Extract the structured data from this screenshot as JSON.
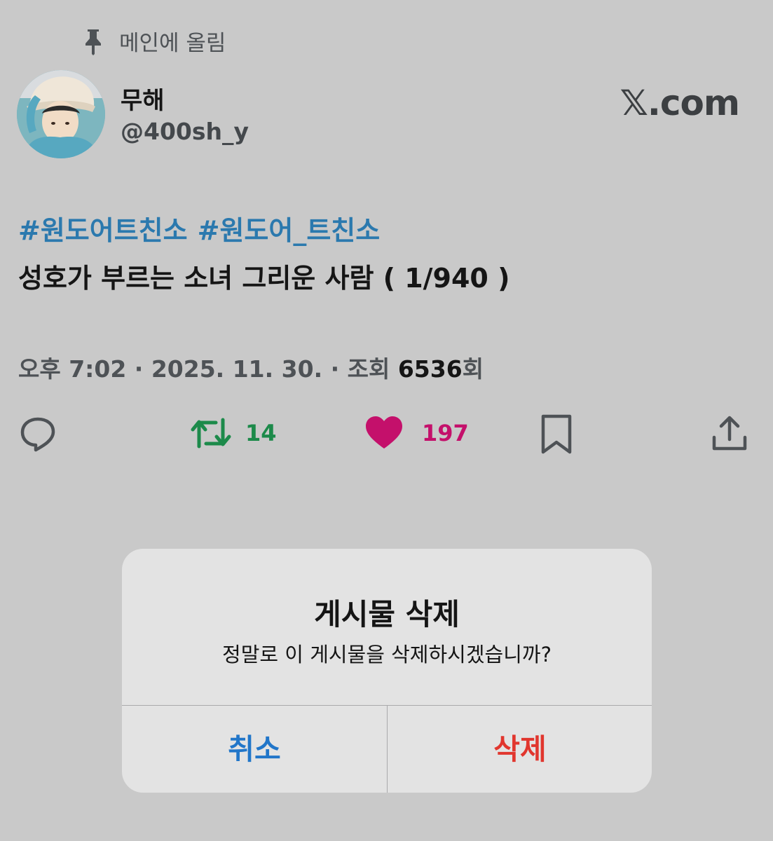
{
  "header": {
    "pinned_label": "메인에 올림",
    "brand": "𝕏.com"
  },
  "user": {
    "name": "무해",
    "handle": "@400sh_y"
  },
  "post": {
    "hashtags": [
      "#원도어트친소",
      "#원도어_트친소"
    ],
    "text": "성호가 부르는 소녀 그리운 사람 ( 1/940 )",
    "meta": {
      "time_prefix": "오후 ",
      "time": "7:02",
      "separator": " · ",
      "date": "2025. 11. 30.",
      "views_label": "조회 ",
      "views": "6536",
      "views_suffix": "회"
    }
  },
  "actions": {
    "retweet_count": "14",
    "like_count": "197"
  },
  "dialog": {
    "title": "게시물 삭제",
    "message": "정말로 이 게시물을 삭제하시겠습니까?",
    "cancel_label": "취소",
    "delete_label": "삭제"
  },
  "colors": {
    "background": "#c9c9c9",
    "hashtag": "#2b79ae",
    "retweet": "#1c8a4a",
    "like": "#c4106b",
    "cancel": "#2176c9",
    "delete": "#e1362e"
  },
  "icons": [
    "pin-icon",
    "reply-icon",
    "retweet-icon",
    "heart-icon",
    "bookmark-icon",
    "share-icon"
  ]
}
